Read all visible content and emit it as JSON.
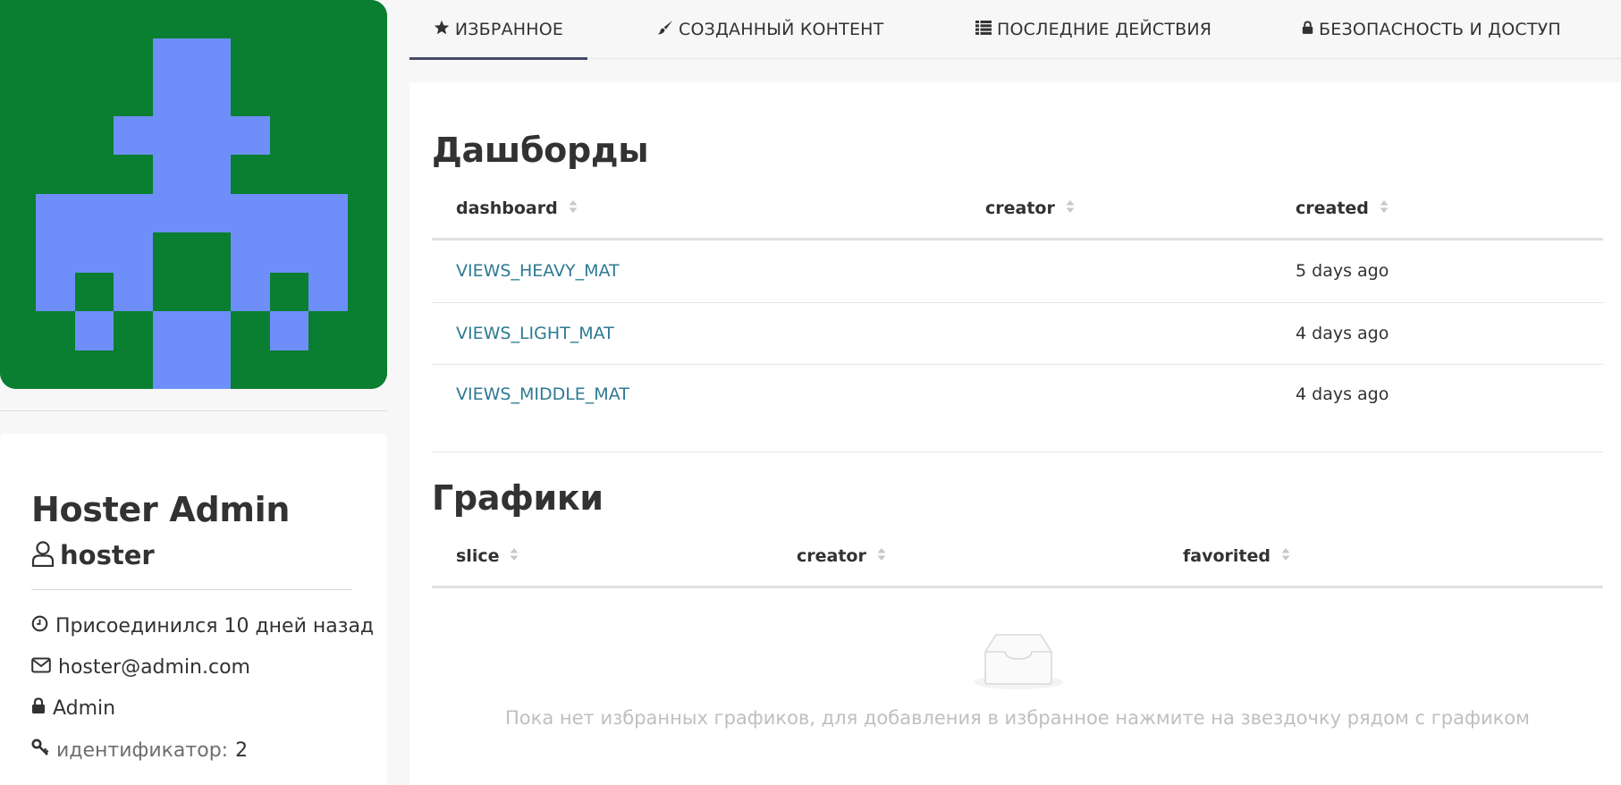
{
  "avatar": {
    "bg": "#0a7e31",
    "fg": "#6e8ffa"
  },
  "profile": {
    "full_name": "Hoster Admin",
    "username": "hoster",
    "joined": "Присоединился 10 дней назад",
    "email": "hoster@admin.com",
    "role": "Admin",
    "id_label": "идентификатор:",
    "id_value": "2"
  },
  "tabs": [
    {
      "label": "ИЗБРАННОЕ",
      "icon": "star-icon",
      "active": true
    },
    {
      "label": "СОЗДАННЫЙ КОНТЕНТ",
      "icon": "paintbrush-icon",
      "active": false
    },
    {
      "label": "ПОСЛЕДНИЕ ДЕЙСТВИЯ",
      "icon": "list-icon",
      "active": false
    },
    {
      "label": "БЕЗОПАСНОСТЬ И ДОСТУП",
      "icon": "lock-icon",
      "active": false
    }
  ],
  "dashboards": {
    "title": "Дашборды",
    "columns": [
      "dashboard",
      "creator",
      "created"
    ],
    "rows": [
      {
        "dashboard": "VIEWS_HEAVY_MAT",
        "creator": "",
        "created": "5 days ago"
      },
      {
        "dashboard": "VIEWS_LIGHT_MAT",
        "creator": "",
        "created": "4 days ago"
      },
      {
        "dashboard": "VIEWS_MIDDLE_MAT",
        "creator": "",
        "created": "4 days ago"
      }
    ]
  },
  "charts": {
    "title": "Графики",
    "columns": [
      "slice",
      "creator",
      "favorited"
    ],
    "empty_text": "Пока нет избранных графиков, для добавления в избранное нажмите на звездочку рядом с графиком"
  }
}
